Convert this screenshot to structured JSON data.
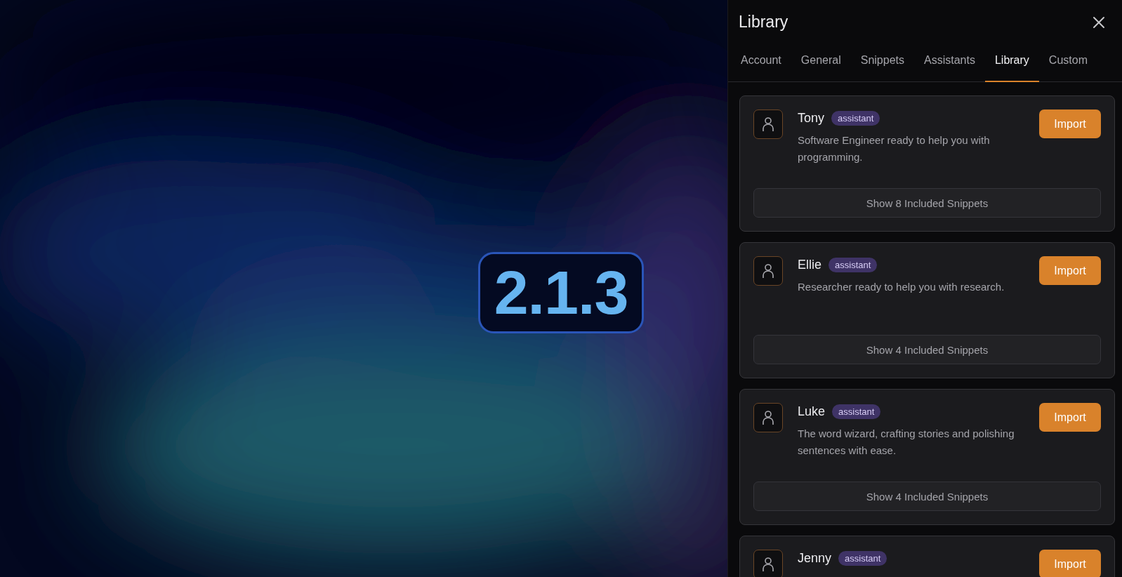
{
  "version_badge": "2.1.3",
  "panel": {
    "title": "Library",
    "tabs": [
      {
        "label": "Account",
        "selected": false
      },
      {
        "label": "General",
        "selected": false
      },
      {
        "label": "Snippets",
        "selected": false
      },
      {
        "label": "Assistants",
        "selected": false
      },
      {
        "label": "Library",
        "selected": true
      },
      {
        "label": "Custom",
        "selected": false
      }
    ],
    "cards": [
      {
        "name": "Tony",
        "tag": "assistant",
        "description": "Software Engineer ready to help you with programming.",
        "import": "Import",
        "snippets": "Show 8 Included Snippets"
      },
      {
        "name": "Ellie",
        "tag": "assistant",
        "description": "Researcher ready to help you with research.",
        "import": "Import",
        "snippets": "Show 4 Included Snippets"
      },
      {
        "name": "Luke",
        "tag": "assistant",
        "description": "The word wizard, crafting stories and polishing sentences with ease.",
        "import": "Import",
        "snippets": "Show 4 Included Snippets"
      },
      {
        "name": "Jenny",
        "tag": "assistant",
        "import": "Import"
      }
    ]
  }
}
